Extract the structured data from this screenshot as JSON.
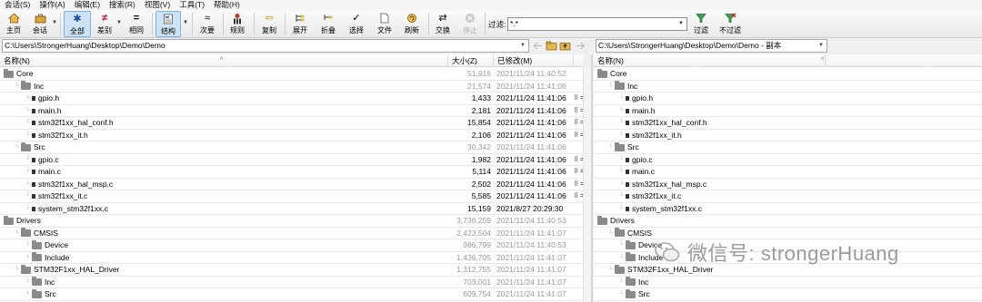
{
  "menu": [
    "会话(S)",
    "操作(A)",
    "编辑(E)",
    "搜索(R)",
    "视图(V)",
    "工具(T)",
    "帮助(H)"
  ],
  "toolbar": {
    "home": "主页",
    "session": "会话",
    "all": "全部",
    "diffs": "差别",
    "same": "相同",
    "structure": "结构",
    "minor": "次要",
    "rules": "规则",
    "copy": "复制",
    "expand": "展开",
    "collapse": "折叠",
    "select": "选择",
    "files": "文件",
    "refresh": "刷新",
    "swap": "交换",
    "stop": "停止",
    "filter_label": "过滤:",
    "filter_value": "*.*",
    "filter_btn": "过滤",
    "no_filter_btn": "不过滤"
  },
  "left": {
    "path": "C:\\Users\\StrongerHuang\\Desktop\\Demo\\Demo",
    "col_name": "名称(N)",
    "col_size": "大小(Z)",
    "col_date": "已修改(M)",
    "rows": [
      {
        "name": "Core",
        "type": "folder",
        "level": 0,
        "size": "51,916",
        "date": "2021/11/24 11:40:52",
        "dim": true,
        "mark": ""
      },
      {
        "name": "Inc",
        "type": "folder",
        "level": 1,
        "size": "21,574",
        "date": "2021/11/24 11:41:06",
        "dim": true,
        "mark": ""
      },
      {
        "name": "gpio.h",
        "type": "file",
        "level": 2,
        "size": "1,433",
        "date": "2021/11/24 11:41:06",
        "dim": false,
        "mark": "⠿ ="
      },
      {
        "name": "main.h",
        "type": "file",
        "level": 2,
        "size": "2,181",
        "date": "2021/11/24 11:41:06",
        "dim": false,
        "mark": "⠿ ="
      },
      {
        "name": "stm32f1xx_hal_conf.h",
        "type": "file",
        "level": 2,
        "size": "15,854",
        "date": "2021/11/24 11:41:06",
        "dim": false,
        "mark": "⠿ ="
      },
      {
        "name": "stm32f1xx_it.h",
        "type": "file",
        "level": 2,
        "size": "2,106",
        "date": "2021/11/24 11:41:06",
        "dim": false,
        "mark": "⠿ ="
      },
      {
        "name": "Src",
        "type": "folder",
        "level": 1,
        "size": "30,342",
        "date": "2021/11/24 11:41:06",
        "dim": true,
        "mark": ""
      },
      {
        "name": "gpio.c",
        "type": "file",
        "level": 2,
        "size": "1,982",
        "date": "2021/11/24 11:41:06",
        "dim": false,
        "mark": "⠿ ="
      },
      {
        "name": "main.c",
        "type": "file",
        "level": 2,
        "size": "5,114",
        "date": "2021/11/24 11:41:06",
        "dim": false,
        "mark": "⠿ ="
      },
      {
        "name": "stm32f1xx_hal_msp.c",
        "type": "file",
        "level": 2,
        "size": "2,502",
        "date": "2021/11/24 11:41:06",
        "dim": false,
        "mark": "⠿ ="
      },
      {
        "name": "stm32f1xx_it.c",
        "type": "file",
        "level": 2,
        "size": "5,585",
        "date": "2021/11/24 11:41:06",
        "dim": false,
        "mark": "⠿ ="
      },
      {
        "name": "system_stm32f1xx.c",
        "type": "file",
        "level": 2,
        "size": "15,159",
        "date": "2021/8/27 20:29:30",
        "dim": false,
        "mark": ""
      },
      {
        "name": "Drivers",
        "type": "folder",
        "level": 0,
        "size": "3,736,259",
        "date": "2021/11/24 11:40:53",
        "dim": true,
        "mark": ""
      },
      {
        "name": "CMSIS",
        "type": "folder",
        "level": 1,
        "size": "2,423,504",
        "date": "2021/11/24 11:41:07",
        "dim": true,
        "mark": ""
      },
      {
        "name": "Device",
        "type": "folder",
        "level": 2,
        "size": "986,799",
        "date": "2021/11/24 11:40:53",
        "dim": true,
        "mark": ""
      },
      {
        "name": "Include",
        "type": "folder",
        "level": 2,
        "size": "1,436,705",
        "date": "2021/11/24 11:41:07",
        "dim": true,
        "mark": ""
      },
      {
        "name": "STM32F1xx_HAL_Driver",
        "type": "folder",
        "level": 1,
        "size": "1,312,755",
        "date": "2021/11/24 11:41:07",
        "dim": true,
        "mark": ""
      },
      {
        "name": "Inc",
        "type": "folder",
        "level": 2,
        "size": "703,001",
        "date": "2021/11/24 11:41:07",
        "dim": true,
        "mark": ""
      },
      {
        "name": "Src",
        "type": "folder",
        "level": 2,
        "size": "609,754",
        "date": "2021/11/24 11:41:07",
        "dim": true,
        "mark": ""
      }
    ]
  },
  "right": {
    "path": "C:\\Users\\StrongerHuang\\Desktop\\Demo\\Demo - 副本",
    "col_name": "名称(N)",
    "rows": [
      {
        "name": "Core",
        "type": "folder",
        "level": 0
      },
      {
        "name": "Inc",
        "type": "folder",
        "level": 1
      },
      {
        "name": "gpio.h",
        "type": "file",
        "level": 2
      },
      {
        "name": "main.h",
        "type": "file",
        "level": 2
      },
      {
        "name": "stm32f1xx_hal_conf.h",
        "type": "file",
        "level": 2
      },
      {
        "name": "stm32f1xx_it.h",
        "type": "file",
        "level": 2
      },
      {
        "name": "Src",
        "type": "folder",
        "level": 1
      },
      {
        "name": "gpio.c",
        "type": "file",
        "level": 2
      },
      {
        "name": "main.c",
        "type": "file",
        "level": 2
      },
      {
        "name": "stm32f1xx_hal_msp.c",
        "type": "file",
        "level": 2
      },
      {
        "name": "stm32f1xx_it.c",
        "type": "file",
        "level": 2
      },
      {
        "name": "system_stm32f1xx.c",
        "type": "file",
        "level": 2
      },
      {
        "name": "Drivers",
        "type": "folder",
        "level": 0
      },
      {
        "name": "CMSIS",
        "type": "folder",
        "level": 1
      },
      {
        "name": "Device",
        "type": "folder",
        "level": 2
      },
      {
        "name": "Include",
        "type": "folder",
        "level": 2
      },
      {
        "name": "STM32F1xx_HAL_Driver",
        "type": "folder",
        "level": 1
      },
      {
        "name": "Inc",
        "type": "folder",
        "level": 2
      },
      {
        "name": "Src",
        "type": "folder",
        "level": 2
      }
    ]
  },
  "watermark": "微信号: strongerHuang"
}
